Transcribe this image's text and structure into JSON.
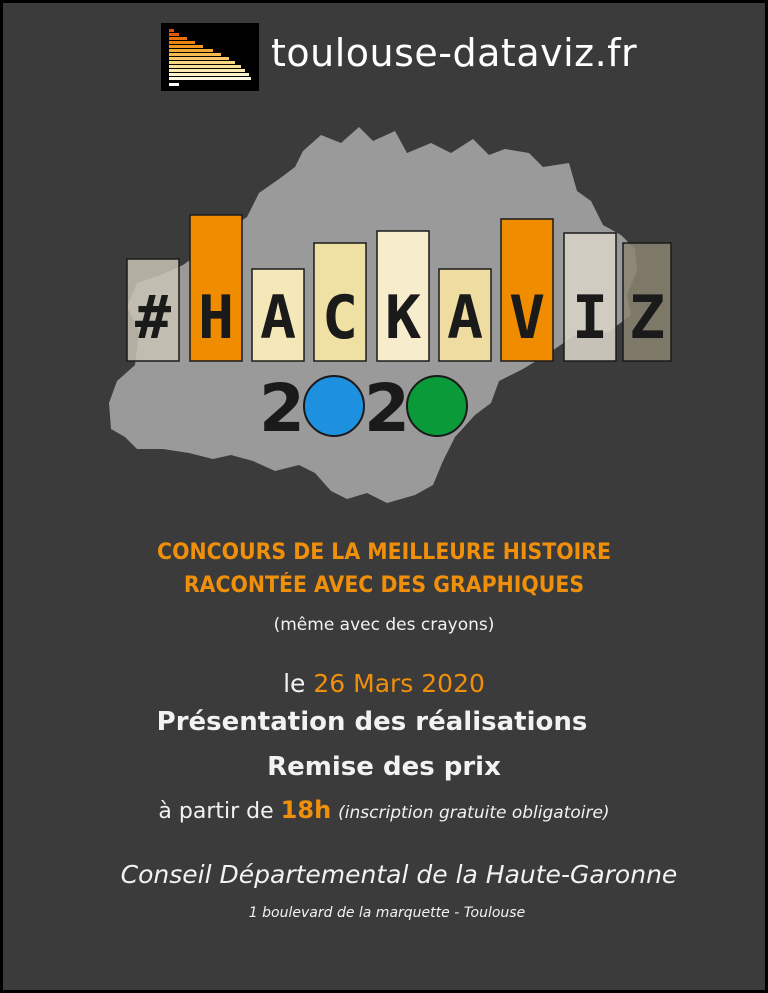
{
  "header": {
    "site_url": "toulouse-dataviz.fr"
  },
  "hero": {
    "letters": [
      "#",
      "H",
      "A",
      "C",
      "K",
      "A",
      "V",
      "I",
      "Z"
    ],
    "year_digits": [
      "2",
      "2"
    ]
  },
  "contest": {
    "title_line1": "CONCOURS DE LA MEILLEURE HISTOIRE",
    "title_line2": "RACONTÉE AVEC DES GRAPHIQUES",
    "note": "(même avec des crayons)"
  },
  "event": {
    "date_prefix": "le",
    "date": "26 Mars 2020",
    "headline1": "Présentation des réalisations",
    "headline2": "Remise des prix",
    "time_prefix": "à partir de",
    "time": "18h",
    "registration_note": "(inscription gratuite obligatoire)",
    "venue": "Conseil Départemental de la Haute-Garonne",
    "address": "1 boulevard de la marquette - Toulouse"
  },
  "colors": {
    "background": "#3b3b3b",
    "accent_orange": "#f0900a",
    "circle_blue": "#1e90e0",
    "circle_green": "#0a9a3a",
    "map_grey": "#9a9a9a"
  }
}
